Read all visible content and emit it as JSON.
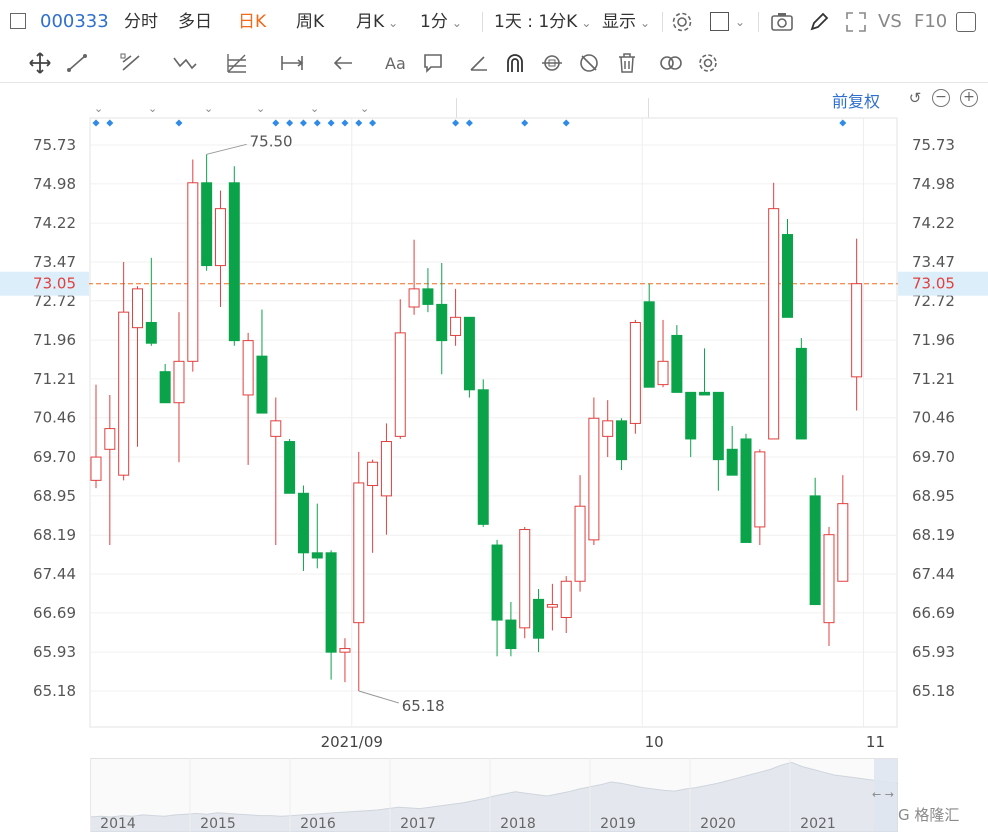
{
  "toolbar": {
    "code": "000333",
    "tabs": [
      "分时",
      "多日",
      "日K",
      "周K",
      "月K",
      "1分",
      "1天 : 1分K",
      "显示"
    ],
    "active_tab": "日K",
    "vs": "VS",
    "f10": "F10"
  },
  "chart_controls": {
    "adjust": "前复权"
  },
  "colors": {
    "up": "#e0403e",
    "down": "#0aa34a",
    "accent": "#2f6fce",
    "current": "#f26a1b"
  },
  "chart_data": {
    "type": "candlestick",
    "y_ticks": [
      "75.73",
      "74.98",
      "74.22",
      "73.47",
      "72.72",
      "71.96",
      "71.21",
      "70.46",
      "69.70",
      "68.95",
      "68.19",
      "67.44",
      "66.69",
      "65.93",
      "65.18"
    ],
    "ylim": [
      64.45,
      76.5
    ],
    "x_labels": [
      {
        "label": "2021/09",
        "index": 19
      },
      {
        "label": "10",
        "index": 40
      },
      {
        "label": "11",
        "index": 56
      }
    ],
    "current_price": "73.05",
    "max_label": "75.50",
    "min_label": "65.18",
    "candles": [
      {
        "o": 69.25,
        "c": 69.7,
        "h": 71.1,
        "l": 69.1
      },
      {
        "o": 69.85,
        "c": 70.25,
        "h": 70.9,
        "l": 68.0
      },
      {
        "o": 69.35,
        "c": 72.5,
        "h": 73.47,
        "l": 69.25
      },
      {
        "o": 72.2,
        "c": 72.95,
        "h": 73.0,
        "l": 69.9
      },
      {
        "o": 72.3,
        "c": 71.9,
        "h": 73.55,
        "l": 71.85
      },
      {
        "o": 71.35,
        "c": 70.75,
        "h": 71.5,
        "l": 70.75
      },
      {
        "o": 70.75,
        "c": 71.55,
        "h": 72.5,
        "l": 69.6
      },
      {
        "o": 71.55,
        "c": 75.0,
        "h": 75.45,
        "l": 71.35
      },
      {
        "o": 75.0,
        "c": 73.4,
        "h": 75.55,
        "l": 73.3
      },
      {
        "o": 73.4,
        "c": 74.5,
        "h": 74.85,
        "l": 72.6
      },
      {
        "o": 75.0,
        "c": 71.95,
        "h": 75.32,
        "l": 71.85
      },
      {
        "o": 70.9,
        "c": 71.95,
        "h": 72.1,
        "l": 69.55
      },
      {
        "o": 71.65,
        "c": 70.55,
        "h": 72.55,
        "l": 70.55
      },
      {
        "o": 70.1,
        "c": 70.4,
        "h": 70.85,
        "l": 68.0
      },
      {
        "o": 70.0,
        "c": 69.0,
        "h": 70.05,
        "l": 69.0
      },
      {
        "o": 69.0,
        "c": 67.85,
        "h": 69.15,
        "l": 67.5
      },
      {
        "o": 67.85,
        "c": 67.75,
        "h": 68.8,
        "l": 67.55
      },
      {
        "o": 67.85,
        "c": 65.93,
        "h": 67.9,
        "l": 65.4
      },
      {
        "o": 65.93,
        "c": 66.0,
        "h": 66.2,
        "l": 65.35
      },
      {
        "o": 66.5,
        "c": 69.2,
        "h": 69.8,
        "l": 65.18
      },
      {
        "o": 69.15,
        "c": 69.6,
        "h": 69.65,
        "l": 67.85
      },
      {
        "o": 68.95,
        "c": 70.0,
        "h": 70.35,
        "l": 68.2
      },
      {
        "o": 70.1,
        "c": 72.1,
        "h": 72.75,
        "l": 70.05
      },
      {
        "o": 72.6,
        "c": 72.95,
        "h": 73.9,
        "l": 72.45
      },
      {
        "o": 72.95,
        "c": 72.65,
        "h": 73.35,
        "l": 72.5
      },
      {
        "o": 72.65,
        "c": 71.95,
        "h": 73.45,
        "l": 71.3
      },
      {
        "o": 72.05,
        "c": 72.4,
        "h": 72.95,
        "l": 71.85
      },
      {
        "o": 72.4,
        "c": 71.0,
        "h": 72.4,
        "l": 70.85
      },
      {
        "o": 71.0,
        "c": 68.4,
        "h": 71.2,
        "l": 68.35
      },
      {
        "o": 68.0,
        "c": 66.55,
        "h": 68.1,
        "l": 65.85
      },
      {
        "o": 66.55,
        "c": 66.0,
        "h": 66.9,
        "l": 65.85
      },
      {
        "o": 66.4,
        "c": 68.3,
        "h": 68.35,
        "l": 66.2
      },
      {
        "o": 66.95,
        "c": 66.2,
        "h": 67.15,
        "l": 65.93
      },
      {
        "o": 66.8,
        "c": 66.85,
        "h": 67.25,
        "l": 66.35
      },
      {
        "o": 66.6,
        "c": 67.3,
        "h": 67.4,
        "l": 66.3
      },
      {
        "o": 67.3,
        "c": 68.75,
        "h": 69.35,
        "l": 67.1
      },
      {
        "o": 68.1,
        "c": 70.45,
        "h": 70.85,
        "l": 68.0
      },
      {
        "o": 70.1,
        "c": 70.4,
        "h": 70.8,
        "l": 69.7
      },
      {
        "o": 70.4,
        "c": 69.65,
        "h": 70.45,
        "l": 69.45
      },
      {
        "o": 70.35,
        "c": 72.3,
        "h": 72.35,
        "l": 70.15
      },
      {
        "o": 72.7,
        "c": 71.05,
        "h": 73.05,
        "l": 71.05
      },
      {
        "o": 71.1,
        "c": 71.55,
        "h": 72.35,
        "l": 71.05
      },
      {
        "o": 72.05,
        "c": 70.95,
        "h": 72.25,
        "l": 70.95
      },
      {
        "o": 70.95,
        "c": 70.05,
        "h": 70.95,
        "l": 69.7
      },
      {
        "o": 70.95,
        "c": 70.9,
        "h": 71.8,
        "l": 70.95
      },
      {
        "o": 70.95,
        "c": 69.65,
        "h": 70.95,
        "l": 69.05
      },
      {
        "o": 69.85,
        "c": 69.35,
        "h": 70.3,
        "l": 69.35
      },
      {
        "o": 70.05,
        "c": 68.05,
        "h": 70.15,
        "l": 68.05
      },
      {
        "o": 68.35,
        "c": 69.8,
        "h": 69.85,
        "l": 68.0
      },
      {
        "o": 70.05,
        "c": 74.5,
        "h": 75.0,
        "l": 70.05
      },
      {
        "o": 74.0,
        "c": 72.4,
        "h": 74.3,
        "l": 72.4
      },
      {
        "o": 71.8,
        "c": 70.05,
        "h": 72.0,
        "l": 70.05
      },
      {
        "o": 68.95,
        "c": 66.85,
        "h": 69.3,
        "l": 66.85
      },
      {
        "o": 66.5,
        "c": 68.2,
        "h": 68.35,
        "l": 66.05
      },
      {
        "o": 67.3,
        "c": 68.8,
        "h": 69.35,
        "l": 67.3
      },
      {
        "o": 71.25,
        "c": 73.05,
        "h": 73.92,
        "l": 70.6
      }
    ],
    "event_marker_indices": [
      0,
      1,
      6,
      13,
      14,
      15,
      16,
      17,
      18,
      19,
      20,
      26,
      27,
      31,
      34,
      54
    ],
    "navigator": {
      "years": [
        "2014",
        "2015",
        "2016",
        "2017",
        "2018",
        "2019",
        "2020",
        "2021"
      ],
      "profile": [
        10,
        11,
        10,
        12,
        11,
        13,
        12,
        11,
        13,
        14,
        15,
        14,
        16,
        15,
        14,
        13,
        12,
        12,
        11,
        12,
        13,
        14,
        15,
        16,
        17,
        18,
        19,
        20,
        22,
        24,
        23,
        22,
        24,
        26,
        28,
        30,
        33,
        36,
        40,
        43,
        46,
        44,
        42,
        40,
        43,
        46,
        50,
        53,
        56,
        60,
        58,
        55,
        52,
        50,
        48,
        47,
        50,
        52,
        55,
        58,
        62,
        66,
        70,
        74,
        78,
        84,
        88,
        82,
        78,
        74,
        70,
        68,
        66,
        64,
        62,
        60,
        58
      ]
    }
  }
}
